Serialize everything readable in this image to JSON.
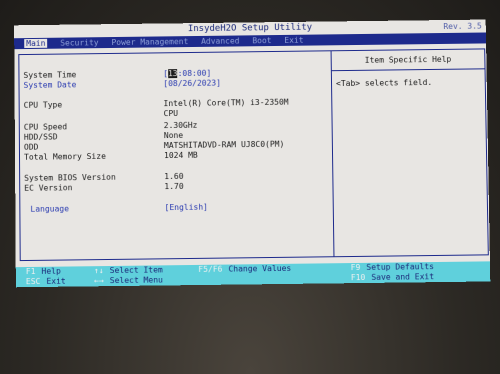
{
  "window": {
    "title": "InsydeH2O Setup Utility",
    "corner": "Rev. 3.5"
  },
  "menu": [
    {
      "label": "Main",
      "active": true
    },
    {
      "label": "Security"
    },
    {
      "label": "Power Management"
    },
    {
      "label": "Advanced"
    },
    {
      "label": "Boot"
    },
    {
      "label": "Exit"
    }
  ],
  "fields": [
    {
      "label": "System Time",
      "value": "[13:08:00]"
    },
    {
      "label": "System Date",
      "value": "[08/26/2023]"
    },
    {
      "label": "CPU Type",
      "value": "Intel(R) Core(TM) i3-2350M",
      "value2": "CPU"
    },
    {
      "label": "CPU Speed",
      "value": "2.30GHz"
    },
    {
      "label": "HDD/SSD",
      "value": "None"
    },
    {
      "label": "ODD",
      "value": "MATSHITADVD-RAM UJ8C0(PM)"
    },
    {
      "label": "Total Memory Size",
      "value": "1024 MB"
    },
    {
      "label": "System BIOS Version",
      "value": "1.60"
    },
    {
      "label": "EC Version",
      "value": "1.70"
    },
    {
      "label": "Language",
      "value": "[English]"
    }
  ],
  "time_parts": {
    "open": "[",
    "hours": "13",
    "rest": ":08:00]"
  },
  "help": {
    "title": "Item Specific Help",
    "text": "<Tab> selects field."
  },
  "footer": [
    {
      "key": "F1",
      "desc": "Help"
    },
    {
      "key": "ESC",
      "desc": "Exit"
    },
    {
      "key": "↑↓",
      "desc": "Select Item"
    },
    {
      "key": "←→",
      "desc": "Select Menu"
    },
    {
      "key": "F5/F6",
      "desc": "Change Values"
    },
    {
      "key": "F9",
      "desc": "Setup Defaults"
    },
    {
      "key": "F10",
      "desc": "Save and Exit"
    }
  ]
}
